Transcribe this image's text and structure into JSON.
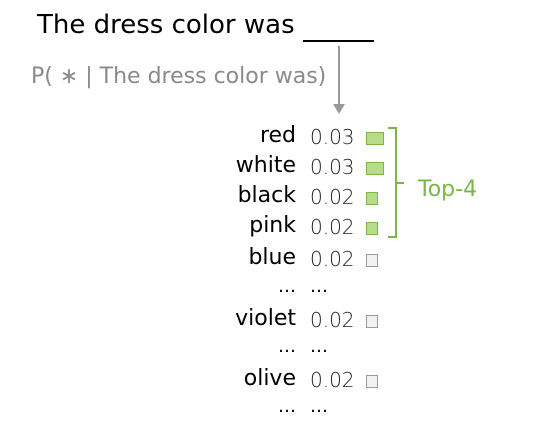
{
  "prompt": "The dress color was",
  "conditional": "P( ∗ | The dress color was)",
  "topk_label": "Top-4",
  "top_color": "#b9dc8a",
  "top_border": "#7ab648",
  "rest_color": "#f2f2f2",
  "rest_border": "#9a9a9a",
  "rows": [
    {
      "word": "red",
      "prob": "0.03",
      "top": true
    },
    {
      "word": "white",
      "prob": "0.03",
      "top": true
    },
    {
      "word": "black",
      "prob": "0.02",
      "top": true
    },
    {
      "word": "pink",
      "prob": "0.02",
      "top": true
    },
    {
      "word": "blue",
      "prob": "0.02",
      "top": false
    },
    {
      "word": "…",
      "prob": "…",
      "top": false
    },
    {
      "word": "violet",
      "prob": "0.02",
      "top": false
    },
    {
      "word": "…",
      "prob": "…",
      "top": false
    },
    {
      "word": "olive",
      "prob": "0.02",
      "top": false
    },
    {
      "word": "…",
      "prob": "…",
      "top": false
    }
  ]
}
